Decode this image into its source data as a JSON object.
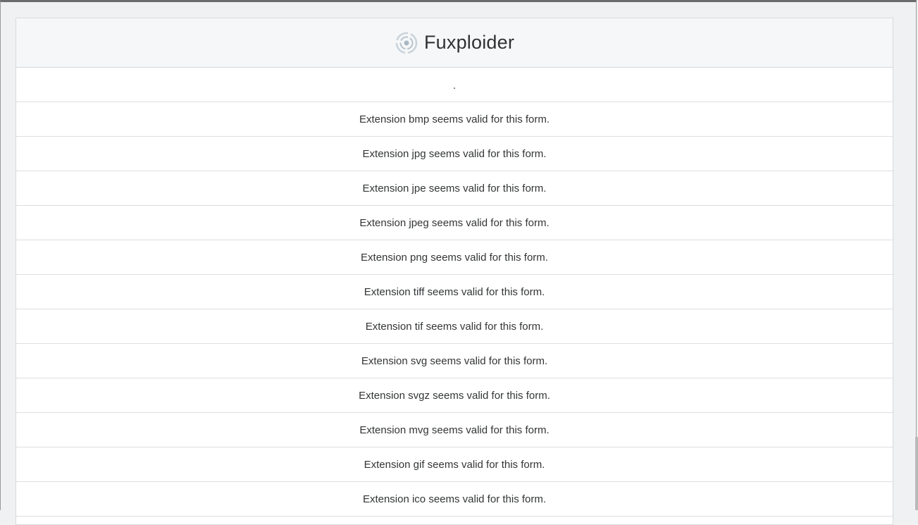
{
  "app": {
    "title": "Fuxploider",
    "logo_icon": "fuxploider-logo-icon"
  },
  "results": [
    ".",
    "Extension bmp seems valid for this form.",
    "Extension jpg seems valid for this form.",
    "Extension jpe seems valid for this form.",
    "Extension jpeg seems valid for this form.",
    "Extension png seems valid for this form.",
    "Extension tiff seems valid for this form.",
    "Extension tif seems valid for this form.",
    "Extension svg seems valid for this form.",
    "Extension svgz seems valid for this form.",
    "Extension mvg seems valid for this form.",
    "Extension gif seems valid for this form.",
    "Extension ico seems valid for this form."
  ]
}
